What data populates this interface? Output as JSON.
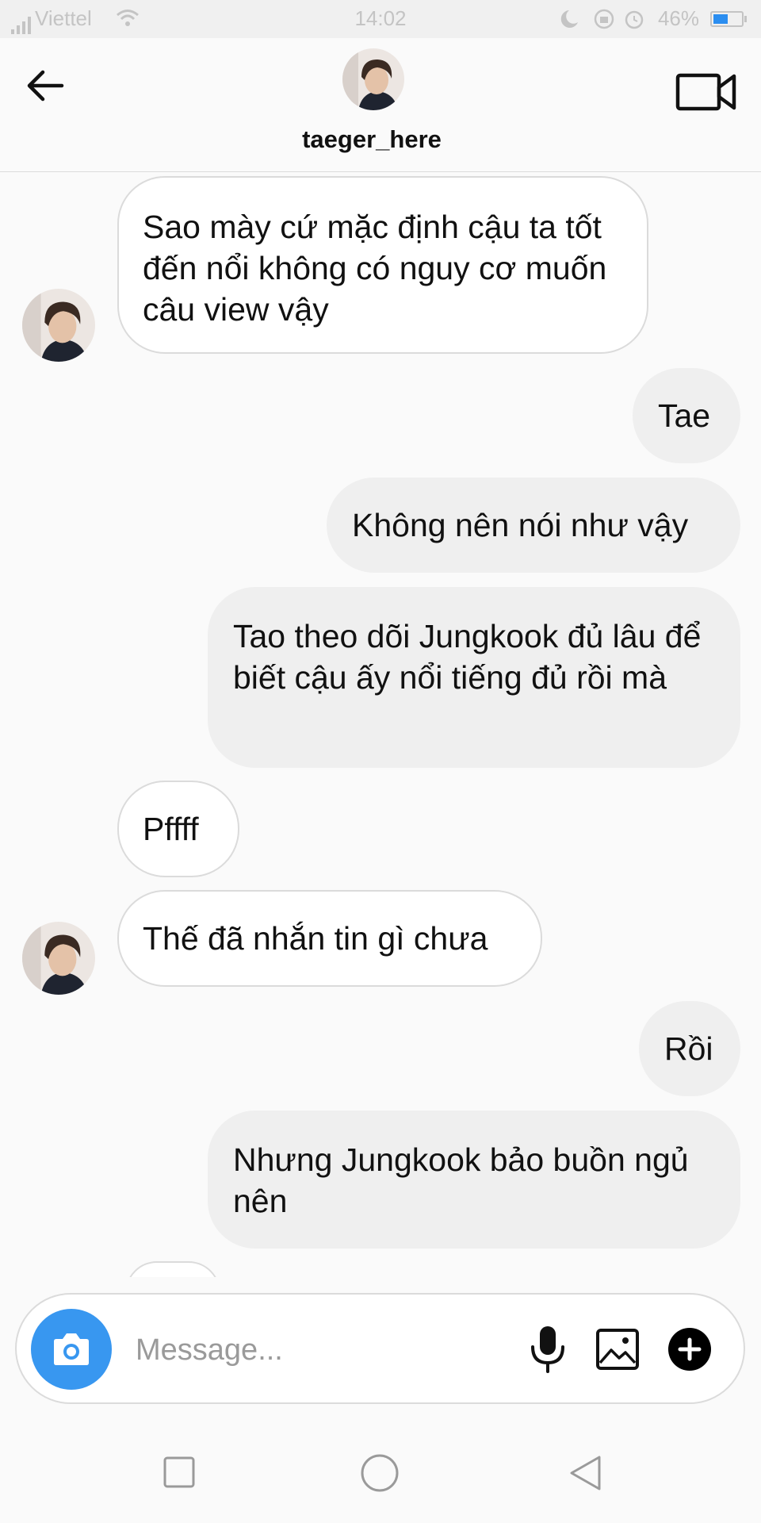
{
  "status_bar": {
    "carrier": "Viettel",
    "time": "14:02",
    "battery_percent": "46%",
    "battery_level": 0.46
  },
  "header": {
    "username": "taeger_here",
    "back_icon": "arrow-left-icon",
    "video_icon": "video-camera-icon"
  },
  "messages": [
    {
      "sender": "them",
      "text": "Sao mày cứ mặc định cậu ta tốt đến nổi không có nguy cơ muốn câu view vậy"
    },
    {
      "sender": "me",
      "text": "Tae"
    },
    {
      "sender": "me",
      "text": "Không nên nói như vậy"
    },
    {
      "sender": "me",
      "text": "Tao theo dõi Jungkook đủ lâu để biết cậu ấy nổi tiếng đủ rồi mà"
    },
    {
      "sender": "them",
      "text": "Pffff"
    },
    {
      "sender": "them",
      "text": "Thế đã nhắn tin gì chưa"
    },
    {
      "sender": "me",
      "text": "Rồi"
    },
    {
      "sender": "me",
      "text": "Nhưng Jungkook bảo buồn ngủ nên"
    }
  ],
  "composer": {
    "placeholder": "Message...",
    "value": "",
    "icons": [
      "camera-icon",
      "microphone-icon",
      "gallery-icon",
      "plus-icon"
    ]
  },
  "navbar": {
    "icons": [
      "recent-apps-icon",
      "home-icon",
      "back-icon"
    ]
  },
  "colors": {
    "accent": "#3897f0",
    "incoming_bubble": "#ffffff",
    "outgoing_bubble": "#efefef",
    "background": "#fafafa"
  }
}
